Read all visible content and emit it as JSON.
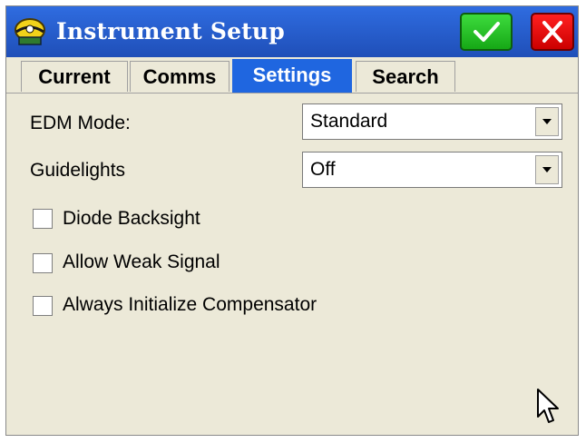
{
  "window": {
    "title": "Instrument Setup",
    "ok_icon": "checkmark-icon",
    "close_icon": "close-icon",
    "accent": "#1f66e0",
    "ok_color": "#16a816",
    "close_color": "#cc0000"
  },
  "tabs": [
    {
      "label": "Current",
      "active": false
    },
    {
      "label": "Comms",
      "active": false
    },
    {
      "label": "Settings",
      "active": true
    },
    {
      "label": "Search",
      "active": false
    }
  ],
  "fields": {
    "edm_mode": {
      "label": "EDM Mode:",
      "value": "Standard"
    },
    "guidelights": {
      "label": "Guidelights",
      "value": "Off"
    }
  },
  "checkboxes": [
    {
      "label": "Diode Backsight",
      "checked": false
    },
    {
      "label": "Allow Weak Signal",
      "checked": false
    },
    {
      "label": "Always Initialize Compensator",
      "checked": false
    }
  ]
}
